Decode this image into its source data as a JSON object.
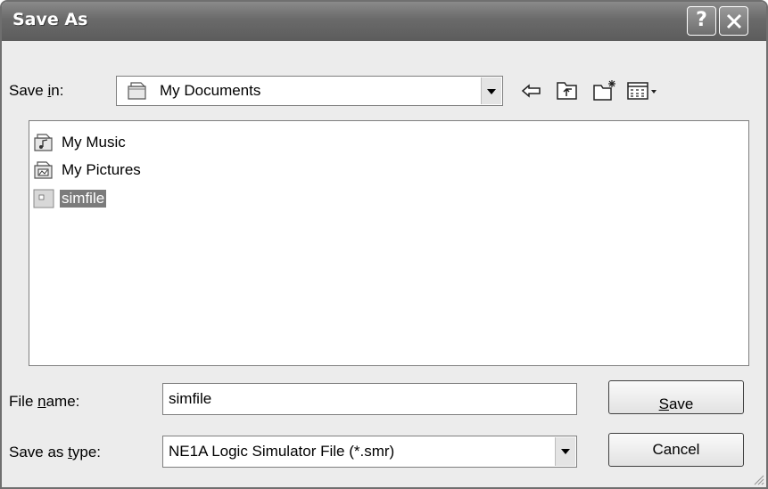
{
  "window": {
    "title": "Save As",
    "help_icon": "help-icon",
    "close_icon": "close-icon"
  },
  "save_in": {
    "label_pre": "Save ",
    "label_accel": "i",
    "label_post": "n:",
    "value": "My Documents",
    "value_icon": "my-documents-icon"
  },
  "toolbar": {
    "icons": [
      "back-icon",
      "up-folder-icon",
      "new-folder-icon",
      "views-menu-icon"
    ]
  },
  "file_list": {
    "items": [
      {
        "name": "My Music",
        "icon": "music-folder-icon",
        "selected": false
      },
      {
        "name": "My Pictures",
        "icon": "pictures-folder-icon",
        "selected": false
      },
      {
        "name": "simfile",
        "icon": "file-icon",
        "selected": true
      }
    ]
  },
  "file_name": {
    "label_pre": "File ",
    "label_accel": "n",
    "label_post": "ame:",
    "value": "simfile"
  },
  "save_as_type": {
    "label_pre": "Save as ",
    "label_accel": "t",
    "label_post": "ype:",
    "value": "NE1A Logic Simulator File (*.smr)"
  },
  "buttons": {
    "save_accel": "S",
    "save_rest": "ave",
    "cancel": "Cancel"
  }
}
